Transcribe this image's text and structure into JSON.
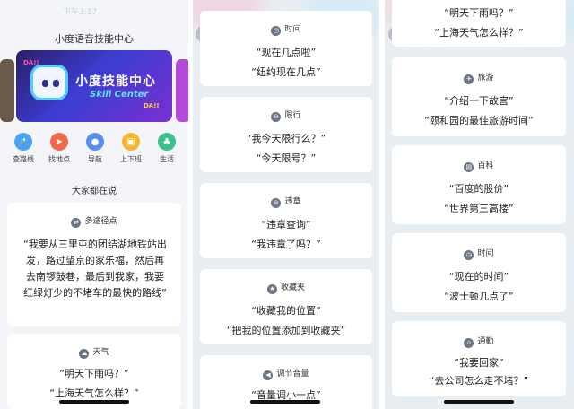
{
  "screen1": {
    "status_time": "下午3:17",
    "title": "小度语音技能中心",
    "banner": {
      "title": "小度技能中心",
      "subtitle": "Skill Center"
    },
    "shortcuts": [
      {
        "label": "查路线",
        "icon": "route-icon",
        "color": "#4aa3f0"
      },
      {
        "label": "找地点",
        "icon": "location-arrow-icon",
        "color": "#f0694a"
      },
      {
        "label": "导航",
        "icon": "map-pin-icon",
        "color": "#5b8def"
      },
      {
        "label": "上下班",
        "icon": "briefcase-icon",
        "color": "#f3b630"
      },
      {
        "label": "生活",
        "icon": "plant-icon",
        "color": "#3fc08a"
      }
    ],
    "section_title": "大家都在说",
    "cards": [
      {
        "title": "多途径点",
        "icon": "route-icon",
        "text": "“我要从三里屯的团结湖地铁站出发，路过望京的家乐福，然后再去南锣鼓巷，最后到我家，我要红绿灯少的不堵车的最快的路线”"
      },
      {
        "title": "天气",
        "icon": "weather-icon",
        "lines": [
          "“明天下雨吗？”",
          "“上海天气怎么样？”"
        ]
      }
    ]
  },
  "screen2": {
    "cards": [
      {
        "title": "时间",
        "icon": "clock-icon",
        "lines": [
          "“现在几点啦”",
          "“纽约现在几点”"
        ]
      },
      {
        "title": "限行",
        "icon": "restriction-icon",
        "lines": [
          "“我今天限行么？”",
          "“今天限号？”"
        ]
      },
      {
        "title": "违章",
        "icon": "violation-icon",
        "lines": [
          "“违章查询”",
          "“我违章了吗？”"
        ]
      },
      {
        "title": "收藏夹",
        "icon": "star-icon",
        "lines": [
          "“收藏我的位置”",
          "“把我的位置添加到收藏夹”"
        ]
      },
      {
        "title": "调节音量",
        "icon": "volume-icon",
        "lines": [
          "“音量调小一点”"
        ]
      }
    ]
  },
  "screen3": {
    "top_lines": [
      "“明天下雨吗？”",
      "“上海天气怎么样？”"
    ],
    "cards": [
      {
        "title": "旅游",
        "icon": "travel-icon",
        "lines": [
          "“介绍一下故宫”",
          "“颐和园的最佳旅游时间”"
        ]
      },
      {
        "title": "百科",
        "icon": "encyclopedia-icon",
        "lines": [
          "“百度的股价”",
          "“世界第三高楼”"
        ]
      },
      {
        "title": "时间",
        "icon": "clock-icon",
        "lines": [
          "“现在的时间”",
          "“波士顿几点了”"
        ]
      },
      {
        "title": "通勤",
        "icon": "home-icon",
        "lines": [
          "“我要回家”",
          "“去公司怎么走不堵？”"
        ]
      }
    ]
  }
}
